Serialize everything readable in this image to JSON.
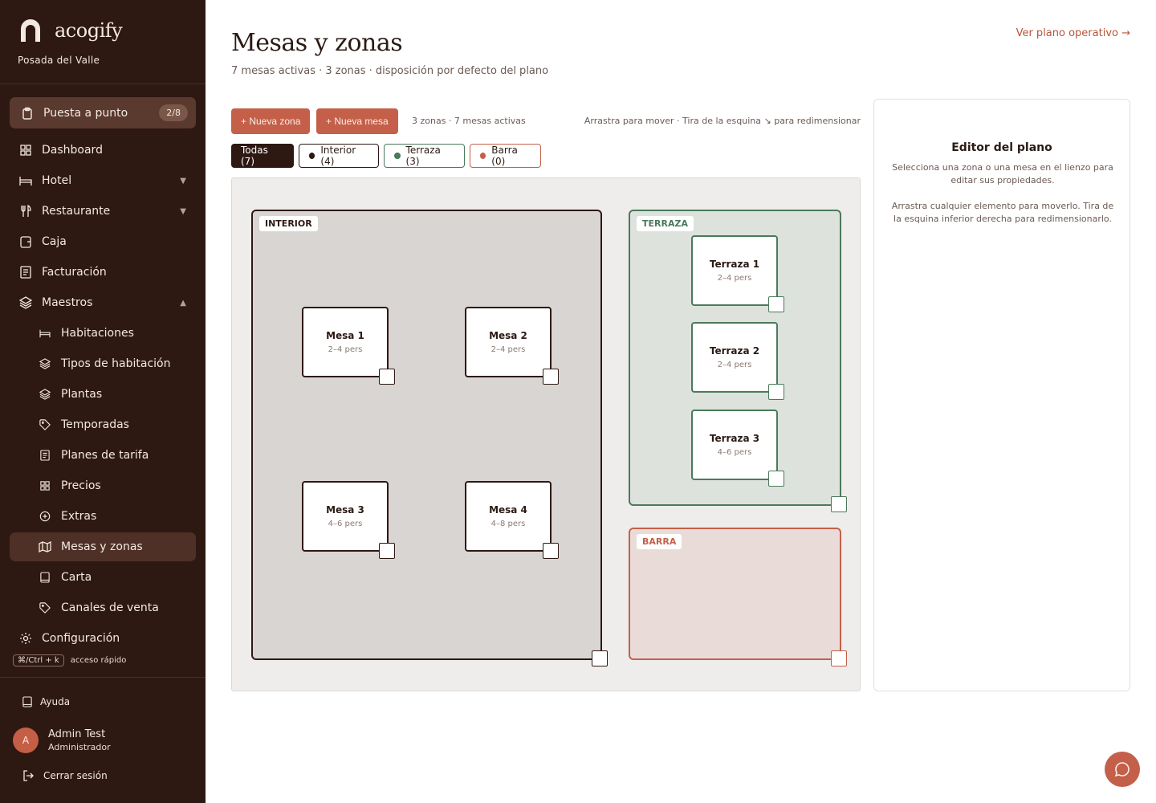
{
  "brand": {
    "name": "acogify",
    "property": "Posada del Valle"
  },
  "sidebar": {
    "setup": {
      "label": "Puesta a punto",
      "badge": "2/8"
    },
    "items": [
      {
        "label": "Dashboard",
        "icon": "grid-icon"
      },
      {
        "label": "Hotel",
        "icon": "bed-icon"
      },
      {
        "label": "Restaurante",
        "icon": "utensils-icon"
      },
      {
        "label": "Caja",
        "icon": "wallet-icon"
      },
      {
        "label": "Facturación",
        "icon": "receipt-icon"
      },
      {
        "label": "Maestros",
        "icon": "layers-icon"
      },
      {
        "label": "Habitaciones",
        "icon": "bed-icon"
      },
      {
        "label": "Tipos de habitación",
        "icon": "layers-icon"
      },
      {
        "label": "Plantas",
        "icon": "layers-icon"
      },
      {
        "label": "Temporadas",
        "icon": "tag-icon"
      },
      {
        "label": "Planes de tarifa",
        "icon": "document-icon"
      },
      {
        "label": "Precios",
        "icon": "grid-icon"
      },
      {
        "label": "Extras",
        "icon": "plus-circle-icon"
      },
      {
        "label": "Mesas y zonas",
        "icon": "map-icon"
      },
      {
        "label": "Carta",
        "icon": "book-icon"
      },
      {
        "label": "Canales de venta",
        "icon": "tag-icon"
      },
      {
        "label": "Configuración",
        "icon": "gear-icon"
      }
    ],
    "shortcut": {
      "key": "⌘/Ctrl + k",
      "label": "acceso rápido"
    },
    "help": "Ayuda",
    "user": {
      "initial": "A",
      "name": "Admin Test",
      "role": "Administrador"
    },
    "logout": "Cerrar sesión"
  },
  "header": {
    "title": "Mesas y zonas",
    "subtitle": "7 mesas activas · 3 zonas · disposición por defecto del plano",
    "plan_link": "Ver plano operativo →"
  },
  "toolbar": {
    "new_zone": "+ Nueva zona",
    "new_table": "+ Nueva mesa",
    "count": "3 zonas · 7 mesas activas",
    "hint": "Arrastra para mover · Tira de la esquina ↘ para redimensionar"
  },
  "filters": [
    {
      "label": "Todas (7)",
      "active": true
    },
    {
      "label": "Interior (4)",
      "color": "#2e1812"
    },
    {
      "label": "Terraza (3)",
      "color": "#4a7a5a"
    },
    {
      "label": "Barra (0)",
      "color": "#c4604a"
    }
  ],
  "zones": [
    {
      "label": "INTERIOR",
      "color": "#2e1812",
      "fill": "#d9d5d3"
    },
    {
      "label": "TERRAZA",
      "color": "#4a7a5a",
      "fill": "#dde2dd"
    },
    {
      "label": "BARRA",
      "color": "#c4604a",
      "fill": "#e9dcd8"
    }
  ],
  "tables": [
    {
      "name": "Mesa 1",
      "capacity": "2–4 pers"
    },
    {
      "name": "Mesa 2",
      "capacity": "2–4 pers"
    },
    {
      "name": "Mesa 3",
      "capacity": "4–6 pers"
    },
    {
      "name": "Mesa 4",
      "capacity": "4–8 pers"
    },
    {
      "name": "Terraza 1",
      "capacity": "2–4 pers"
    },
    {
      "name": "Terraza 2",
      "capacity": "2–4 pers"
    },
    {
      "name": "Terraza 3",
      "capacity": "4–6 pers"
    }
  ],
  "editor": {
    "title": "Editor del plano",
    "text1": "Selecciona una zona o una mesa en el lienzo para editar sus propiedades.",
    "text2": "Arrastra cualquier elemento para moverlo. Tira de la esquina inferior derecha para redimensionarlo."
  },
  "fab": {
    "icon": "chat-icon"
  }
}
